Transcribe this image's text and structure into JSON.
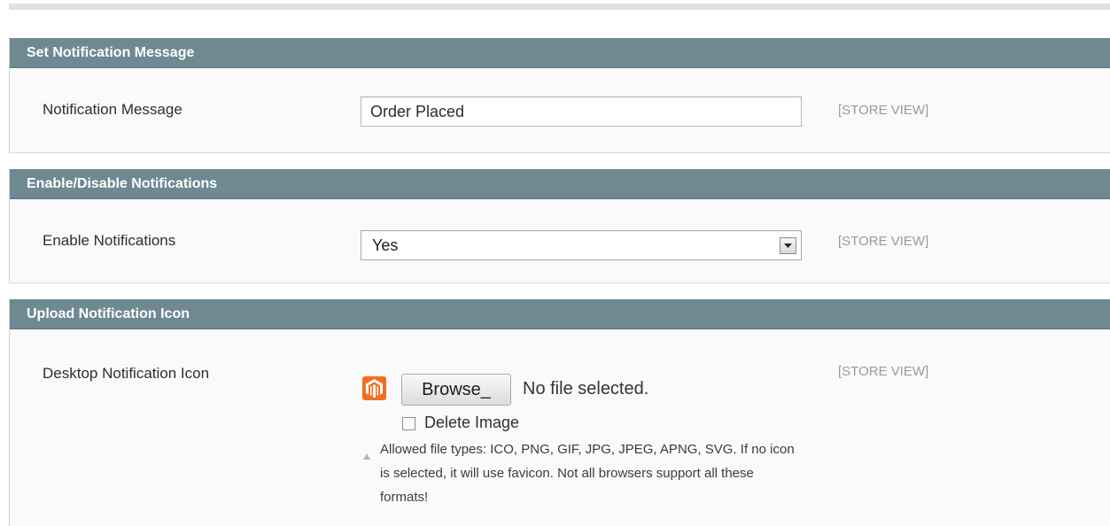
{
  "sections": [
    {
      "title": "Set Notification Message",
      "field_label": "Notification Message",
      "input_value": "Order Placed",
      "scope": "[STORE VIEW]"
    },
    {
      "title": "Enable/Disable Notifications",
      "field_label": "Enable Notifications",
      "selected_value": "Yes",
      "scope": "[STORE VIEW]"
    },
    {
      "title": "Upload Notification Icon",
      "field_label": "Desktop Notification Icon",
      "icon": "magento-logo-icon",
      "browse_label": "Browse_",
      "file_status": "No file selected.",
      "delete_label": "Delete Image",
      "delete_checked": false,
      "note": "Allowed file types: ICO, PNG, GIF, JPG, JPEG, APNG, SVG. If no icon is selected, it will use favicon. Not all browsers support all these formats!",
      "scope": "[STORE VIEW]"
    }
  ],
  "colors": {
    "header_bg": "#6f8992",
    "body_bg": "#fafafa",
    "scope_text": "#9a9a9a",
    "icon_orange": "#f26f21"
  }
}
